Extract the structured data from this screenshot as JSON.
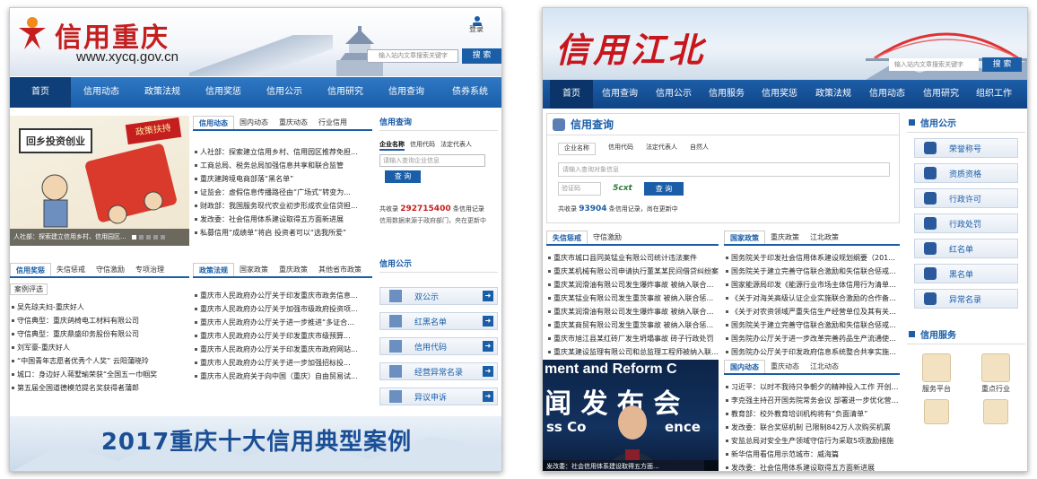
{
  "left": {
    "logo_text": "信用重庆",
    "url": "www.xycq.gov.cn",
    "login": "登录",
    "search_placeholder": "输入站内文章搜索关键字",
    "search_button": "搜 索",
    "nav": [
      "首页",
      "信用动态",
      "政策法规",
      "信用奖惩",
      "信用公示",
      "信用研究",
      "信用查询",
      "债券系统"
    ],
    "banner": {
      "sign": "回乡投资创业",
      "flag": "政策扶持",
      "caption": "人社部：探索建立信用乡村、信用园区..."
    },
    "news": {
      "tabs": [
        "信用动态",
        "国内动态",
        "重庆动态",
        "行业信用"
      ],
      "items": [
        "人社部：探索建立信用乡村、信用园区推荐免担...",
        "工商总局、税务总局加强信息共享和联合监管",
        "重庆建跨境电商部落“黑名单”",
        "证监会：虚假信息传播路径由“广场式”转变为...",
        "财政部：我国服务现代农业初步形成农业信贷担...",
        "发改委：社会信用体系建设取得五方面新进展",
        "私募信用“成绩单”将启 投资者可以“选我所爱”"
      ]
    },
    "query": {
      "title": "信用查询",
      "tabs": [
        "企业名称",
        "信用代码",
        "法定代表人"
      ],
      "placeholder": "请输入查询企业信息",
      "button": "查 询",
      "count_prefix": "共收录",
      "count": "292715400",
      "count_suffix": "条信用记录",
      "note": "信用数据来源于政府部门，央在更新中"
    },
    "honors": {
      "tabs": [
        "信用奖惩",
        "失信惩戒",
        "守信激励",
        "专项治理"
      ],
      "sub": "案例评选",
      "items": [
        "吴先琼夫妇-重庆好人",
        "守信典型：重庆鸽椅电工材料有限公司",
        "守信典型：重庆鼎盛印务股份有限公司",
        "刘军豪-重庆好人",
        "“中国青年志愿者优秀个人奖” 云阳蒲晓玲",
        "城口：身边好人蒋墅瑜荣获“全国五一巾帼奖",
        "第五届全国道德模范提名奖获得者蒲郎"
      ]
    },
    "policy": {
      "tabs": [
        "政策法规",
        "国家政策",
        "重庆政策",
        "其他省市政策"
      ],
      "items": [
        "重庆市人民政府办公厅关于印发重庆市政务信息...",
        "重庆市人民政府办公厅关于加强市级政府投资项...",
        "重庆市人民政府办公厅关于进一步推进“多证合...",
        "重庆市人民政府办公厅关于印发重庆市级预算...",
        "重庆市人民政府办公厅关于印发重庆市政府网站...",
        "重庆市人民政府办公厅关于进一步加强招标投...",
        "重庆市人民政府关于向中国（重庆）自由贸易试..."
      ]
    },
    "publicity": {
      "title": "信用公示",
      "items": [
        "双公示",
        "红黑名单",
        "信用代码",
        "经营异常名录",
        "异议申诉"
      ]
    },
    "bottom_banner": "2017重庆十大信用典型案例"
  },
  "right": {
    "logo_text": "信用江北",
    "search_placeholder": "输入站内文章搜索关键字",
    "search_button": "搜 索",
    "nav": [
      "首页",
      "信用查询",
      "信用公示",
      "信用服务",
      "信用奖惩",
      "政策法规",
      "信用动态",
      "信用研究",
      "组织工作"
    ],
    "query": {
      "title": "信用查询",
      "tabs": [
        "企业名称",
        "信用代码",
        "法定代表人",
        "自然人"
      ],
      "placeholder": "请输入查询对象信息",
      "captcha_placeholder": "验证码",
      "captcha": "5cxt",
      "button": "查 询",
      "count_prefix": "共收录",
      "count": "93904",
      "count_suffix": "条信用记录，尚在更新中"
    },
    "publicity": {
      "title": "信用公示",
      "items": [
        "荣誉称号",
        "资质资格",
        "行政许可",
        "行政处罚",
        "红名单",
        "黑名单",
        "异常名录"
      ]
    },
    "punish": {
      "tabs": [
        "失信惩戒",
        "守信激励"
      ],
      "items": [
        "重庆市城口县同英锰业有限公司统计违法案件",
        "重庆某机械有限公司申请执行董某某民间借贷纠纷案",
        "重庆某润滑油有限公司发生爆炸事故 被纳入联合惩...",
        "重庆某锰业有限公司发生重茨事故 被纳入联合惩...",
        "重庆某润滑油有限公司发生爆炸事故 被纳入联合惩...",
        "重庆某商贸有限公司发生重茨事故 被纳入联合惩...",
        "重庆市旭江县某红砖厂发生坍塌事故 砖子行政处罚",
        "重庆某建设监理有限公司和总监理工程师被纳入联合..."
      ]
    },
    "policy": {
      "tabs": [
        "国家政策",
        "重庆政策",
        "江北政策"
      ],
      "items": [
        "国务院关于印发社会信用体系建设规划纲要（201...",
        "国务院关于建立完善守信联合激励和失信联合惩戒...",
        "国家能源局印发《能源行业市场主体信用行为清单（...",
        "《关于对海关高级认证企业实施联合激励的合作备忘...",
        "《关于对农资领域严重失信生产经营单位及其有关人...",
        "国务院关于建立完善守信联合激励和失信联合惩戒...",
        "国务院办公厅关于进一步改革完善药品生产流通使用...",
        "国务院办公厅关于印发政府信息系统整合共享实施方..."
      ]
    },
    "photo": {
      "headline_en": "ment and Reform C",
      "headline_cn": "闻 发 布 会",
      "sub_en": "ss Co",
      "sub_en2": "ence",
      "caption": "发改委：社会信用体系建设取得五方面..."
    },
    "news": {
      "tabs": [
        "国内动态",
        "重庆动态",
        "江北动态"
      ],
      "items": [
        "习近平：以时不我待只争朝夕的精神投入工作 开创 ...",
        "李克强主持召开国务院常务会议 部署进一步优化营 ...",
        "教育部：校外教育培训机构将有“负面清单”",
        "发改委：联合奖惩机制 已限制842万人次购买机票",
        "安监总局对安全生产领域守信行为采取5项激励措施",
        "新华信用看信用示范城市：威海篇",
        "发改委：社会信用体系建设取得五方面新进展"
      ]
    },
    "services": {
      "title": "信用服务",
      "items": [
        "服务平台",
        "重点行业"
      ]
    }
  }
}
